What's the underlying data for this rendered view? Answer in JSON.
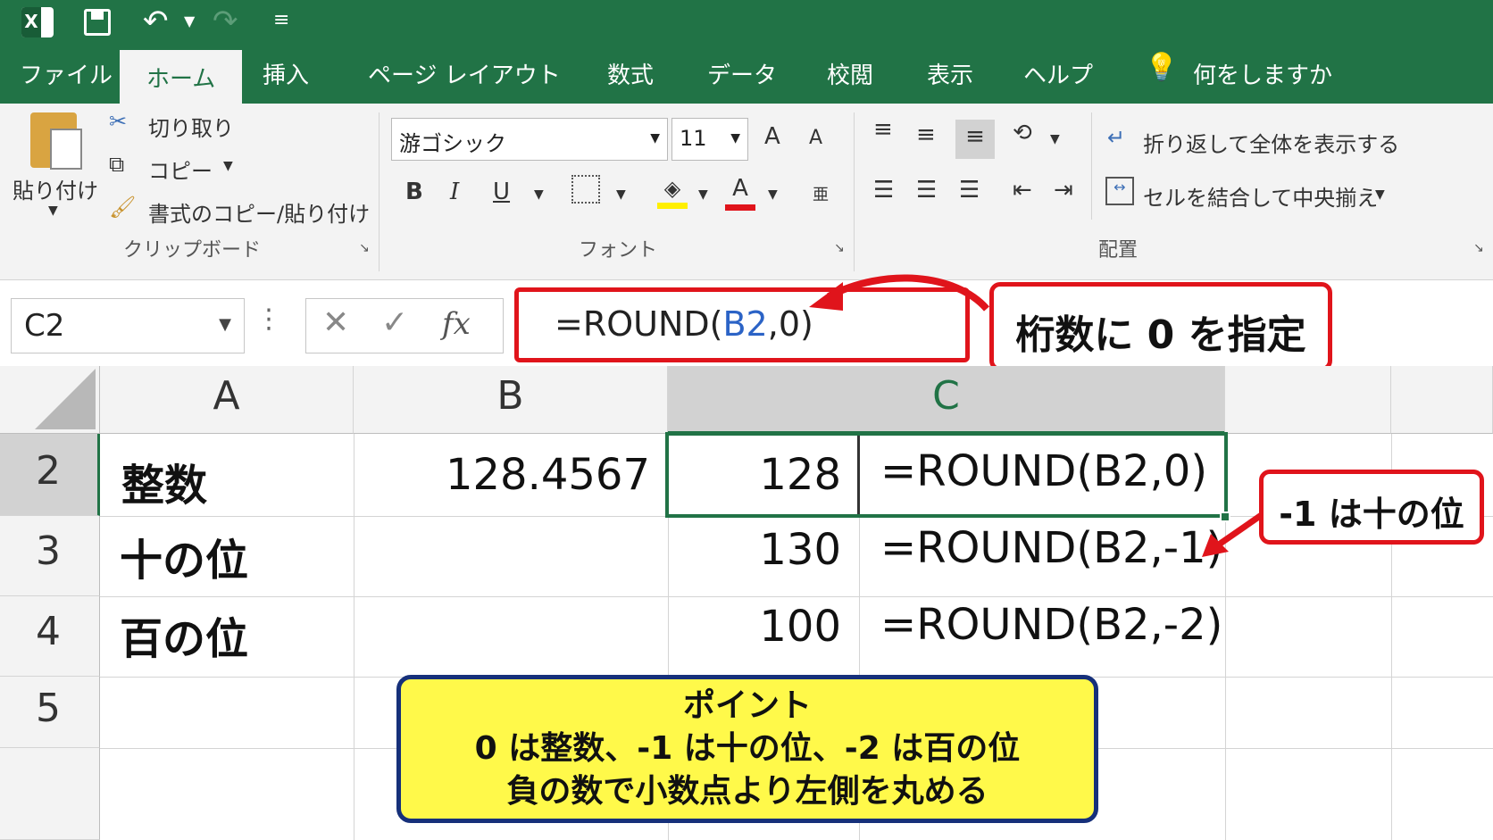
{
  "tabs": [
    "ファイル",
    "ホーム",
    "挿入",
    "ページ レイアウト",
    "数式",
    "データ",
    "校閲",
    "表示",
    "ヘルプ"
  ],
  "tell_me": "何をしますか",
  "clipboard": {
    "paste": "貼り付け",
    "cut": "切り取り",
    "copy": "コピー",
    "format_painter": "書式のコピー/貼り付け",
    "group": "クリップボード"
  },
  "font": {
    "name": "游ゴシック",
    "size": "11",
    "bold": "B",
    "italic": "I",
    "underline": "U",
    "grow": "A",
    "shrink": "A",
    "color_letter": "A",
    "group": "フォント"
  },
  "alignment": {
    "wrap": "折り返して全体を表示する",
    "merge": "セルを結合して中央揃え",
    "group": "配置"
  },
  "formula_bar": {
    "name_box": "C2",
    "fx": "fx",
    "formula_prefix": "=ROUND(",
    "formula_ref": "B2",
    "formula_suffix": ",0)"
  },
  "callouts": {
    "digits": "桁数に 0 を指定",
    "tens": "-1 は十の位"
  },
  "columns": [
    "A",
    "B",
    "C"
  ],
  "rows": [
    {
      "num": "2",
      "a": "整数",
      "b": "128.4567",
      "c": "128",
      "d": "=ROUND(B2,0)"
    },
    {
      "num": "3",
      "a": "十の位",
      "b": "",
      "c": "130",
      "d": "=ROUND(B2,-1)"
    },
    {
      "num": "4",
      "a": "百の位",
      "b": "",
      "c": "100",
      "d": "=ROUND(B2,-2)"
    },
    {
      "num": "5",
      "a": "",
      "b": "",
      "c": "",
      "d": ""
    }
  ],
  "point": {
    "title": "ポイント",
    "line1": "0 は整数、-1 は十の位、-2 は百の位",
    "line2": "負の数で小数点より左側を丸める"
  },
  "colors": {
    "excel_green": "#217346",
    "callout_red": "#e0141b",
    "point_yellow": "#fff94a",
    "point_border": "#16307a",
    "ref_blue": "#2b63c6"
  }
}
